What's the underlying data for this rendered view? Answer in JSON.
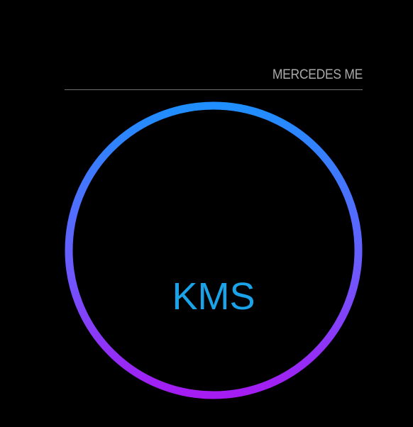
{
  "module": {
    "title": "MERCEDES ME"
  },
  "gauge": {
    "unit_label": "KMS",
    "ring_gradient": [
      "#1f8fff",
      "#a51cf2"
    ],
    "glow_color": "#1a1aa6",
    "unit_color": "#1aa3e8",
    "background": "#000000"
  },
  "icons": []
}
